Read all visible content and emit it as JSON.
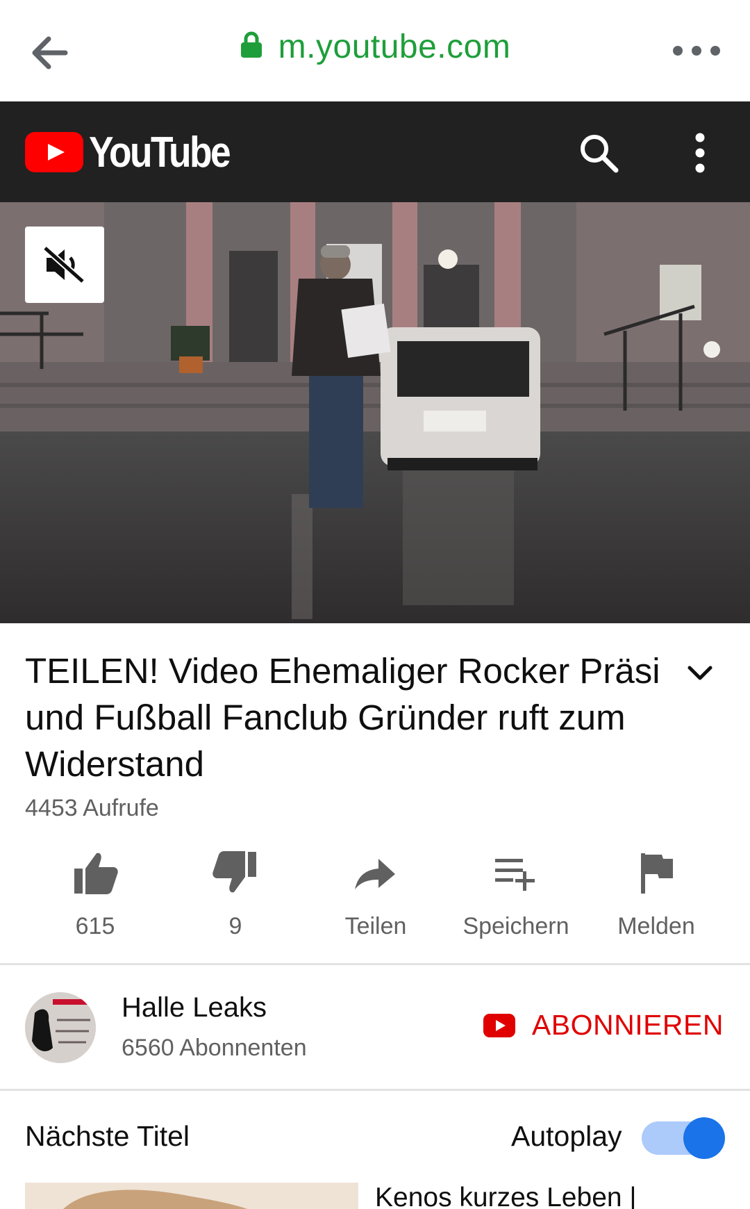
{
  "browser": {
    "url": "m.youtube.com",
    "back_icon": "back-arrow-icon",
    "lock_icon": "lock-icon",
    "menu_icon": "more-horizontal-icon",
    "url_color": "#1e9e3a"
  },
  "header": {
    "logo_text": "YouTube",
    "search_icon": "search-icon",
    "menu_icon": "more-vertical-icon",
    "background": "#212121"
  },
  "player": {
    "mute_icon": "muted-speaker-icon"
  },
  "video": {
    "title": "TEILEN! Video Ehemaliger Rocker Präsi und Fußball Fanclub Gründer ruft zum Widerstand",
    "views": "4453 Aufrufe",
    "expand_icon": "chevron-down-icon"
  },
  "actions": [
    {
      "label": "615",
      "icon": "thumbs-up-icon"
    },
    {
      "label": "9",
      "icon": "thumbs-down-icon"
    },
    {
      "label": "Teilen",
      "icon": "share-icon"
    },
    {
      "label": "Speichern",
      "icon": "playlist-add-icon"
    },
    {
      "label": "Melden",
      "icon": "flag-icon"
    }
  ],
  "channel": {
    "name": "Halle Leaks",
    "subscribers": "6560 Abonnenten",
    "subscribe_label": "ABONNIEREN",
    "accent": "#e00000"
  },
  "up_next": {
    "title": "Nächste Titel",
    "autoplay_label": "Autoplay",
    "autoplay_on": true,
    "next_video_title": "Kenos kurzes Leben |"
  }
}
